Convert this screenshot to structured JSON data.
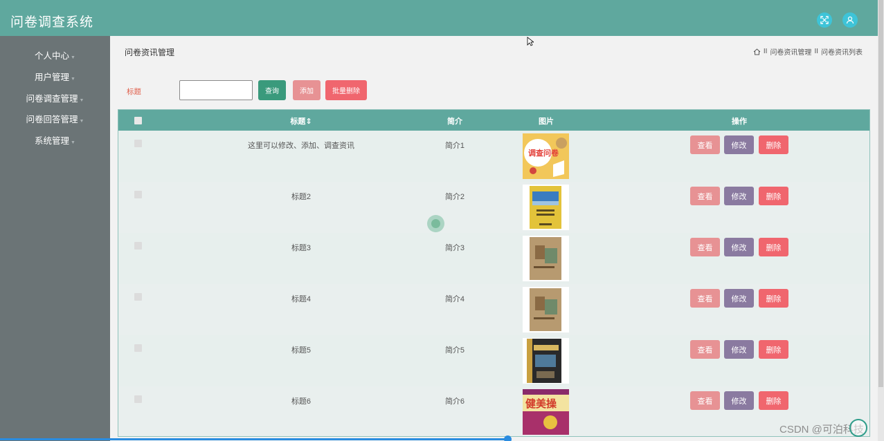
{
  "header": {
    "app_title": "问卷调查系统",
    "icons": [
      "fullscreen-icon",
      "user-icon"
    ],
    "color": "#5fa89e"
  },
  "sidebar": {
    "items": [
      {
        "label": "个人中心"
      },
      {
        "label": "用户管理"
      },
      {
        "label": "问卷调查管理"
      },
      {
        "label": "问卷回答管理"
      },
      {
        "label": "系统管理"
      }
    ]
  },
  "page": {
    "title": "问卷资讯管理",
    "breadcrumb": [
      "问卷资讯管理",
      "问卷资讯列表"
    ],
    "breadcrumb_sep": "II"
  },
  "search": {
    "label": "标题",
    "value": "",
    "query_button": "查询",
    "add_button": "添加",
    "batch_delete_button": "批量删除"
  },
  "table": {
    "columns": [
      "标题",
      "简介",
      "图片",
      "操作"
    ],
    "sort_icon": "⇕",
    "rows": [
      {
        "title": "这里可以修改、添加、调查资讯",
        "summary": "简介1",
        "image": "survey-cover"
      },
      {
        "title": "标题2",
        "summary": "简介2",
        "image": "book-blue"
      },
      {
        "title": "标题3",
        "summary": "简介3",
        "image": "book-brown"
      },
      {
        "title": "标题4",
        "summary": "简介4",
        "image": "book-brown"
      },
      {
        "title": "标题5",
        "summary": "简介5",
        "image": "book-java"
      },
      {
        "title": "标题6",
        "summary": "简介6",
        "image": "book-fitness"
      }
    ],
    "actions": {
      "view": "查看",
      "edit": "修改",
      "delete": "删除"
    }
  },
  "watermark": "CSDN @可泊科技",
  "colors": {
    "accent": "#5fa89e",
    "sidebar": "#6b7476",
    "query": "#3a9a7c",
    "add": "#e79294",
    "delete": "#f0666e",
    "edit": "#8a7aa0"
  }
}
